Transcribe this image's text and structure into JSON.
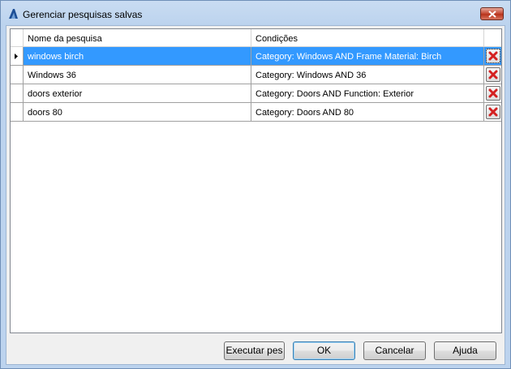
{
  "window": {
    "title": "Gerenciar pesquisas salvas",
    "icon": "autodesk-logo-icon",
    "close_icon": "close-icon"
  },
  "grid": {
    "columns": [
      "Nome da pesquisa",
      "Condições"
    ],
    "rows": [
      {
        "name": "windows birch",
        "conditions": "Category: Windows AND Frame Material: Birch",
        "selected": true
      },
      {
        "name": "Windows 36",
        "conditions": "Category: Windows AND 36",
        "selected": false
      },
      {
        "name": "doors exterior",
        "conditions": "Category: Doors AND Function: Exterior",
        "selected": false
      },
      {
        "name": "doors 80",
        "conditions": "Category: Doors AND 80",
        "selected": false
      }
    ],
    "delete_icon": "red-x-delete-icon",
    "current_row_icon": "row-pointer-icon"
  },
  "buttons": {
    "run": "Executar pes",
    "ok": "OK",
    "cancel": "Cancelar",
    "help": "Ajuda"
  },
  "colors": {
    "selection": "#3399ff",
    "delete_x": "#d42020",
    "title_bar": "#bcd3ee"
  }
}
